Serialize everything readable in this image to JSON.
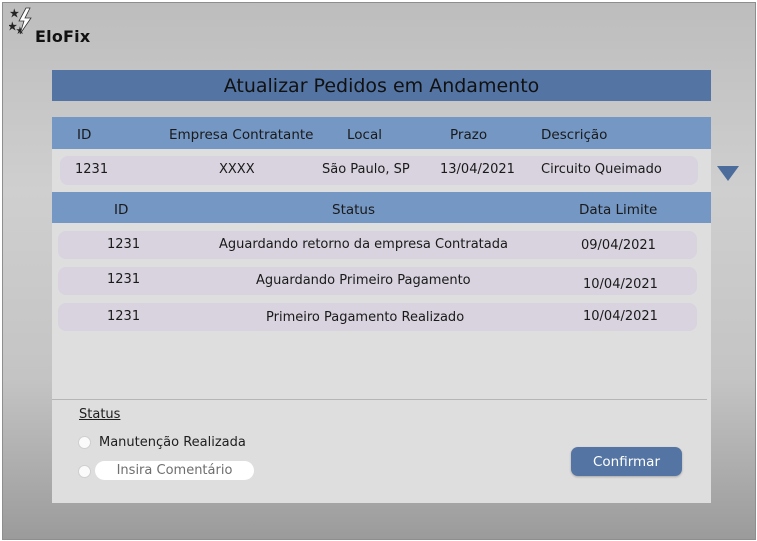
{
  "app": {
    "name": "EloFix"
  },
  "page": {
    "title": "Atualizar Pedidos em Andamento"
  },
  "order_table": {
    "headers": [
      "ID",
      "Empresa Contratante",
      "Local",
      "Prazo",
      "Descrição"
    ],
    "rows": [
      {
        "id": "1231",
        "empresa": "XXXX",
        "local": "São Paulo, SP",
        "prazo": "13/04/2021",
        "descricao": "Circuito Queimado"
      }
    ]
  },
  "status_table": {
    "headers": [
      "ID",
      "Status",
      "Data Limite"
    ],
    "rows": [
      {
        "id": "1231",
        "status": "Aguardando retorno da empresa Contratada",
        "data": "09/04/2021"
      },
      {
        "id": "1231",
        "status": "Aguardando Primeiro Pagamento",
        "data": "10/04/2021"
      },
      {
        "id": "1231",
        "status": "Primeiro Pagamento Realizado",
        "data": "10/04/2021"
      }
    ]
  },
  "status_form": {
    "label": "Status",
    "option_manutencao": "Manutenção Realizada",
    "comment_placeholder": "Insira Comentário",
    "comment_value": "",
    "confirm_label": "Confirmar"
  },
  "icons": {
    "logo": "lightning-stars-icon",
    "expand": "triangle-down-icon"
  },
  "colors": {
    "title_bar": "#5475a3",
    "table_header": "#7497c4",
    "row_pill": "#d8d3de",
    "confirm_button": "#5475a3"
  }
}
